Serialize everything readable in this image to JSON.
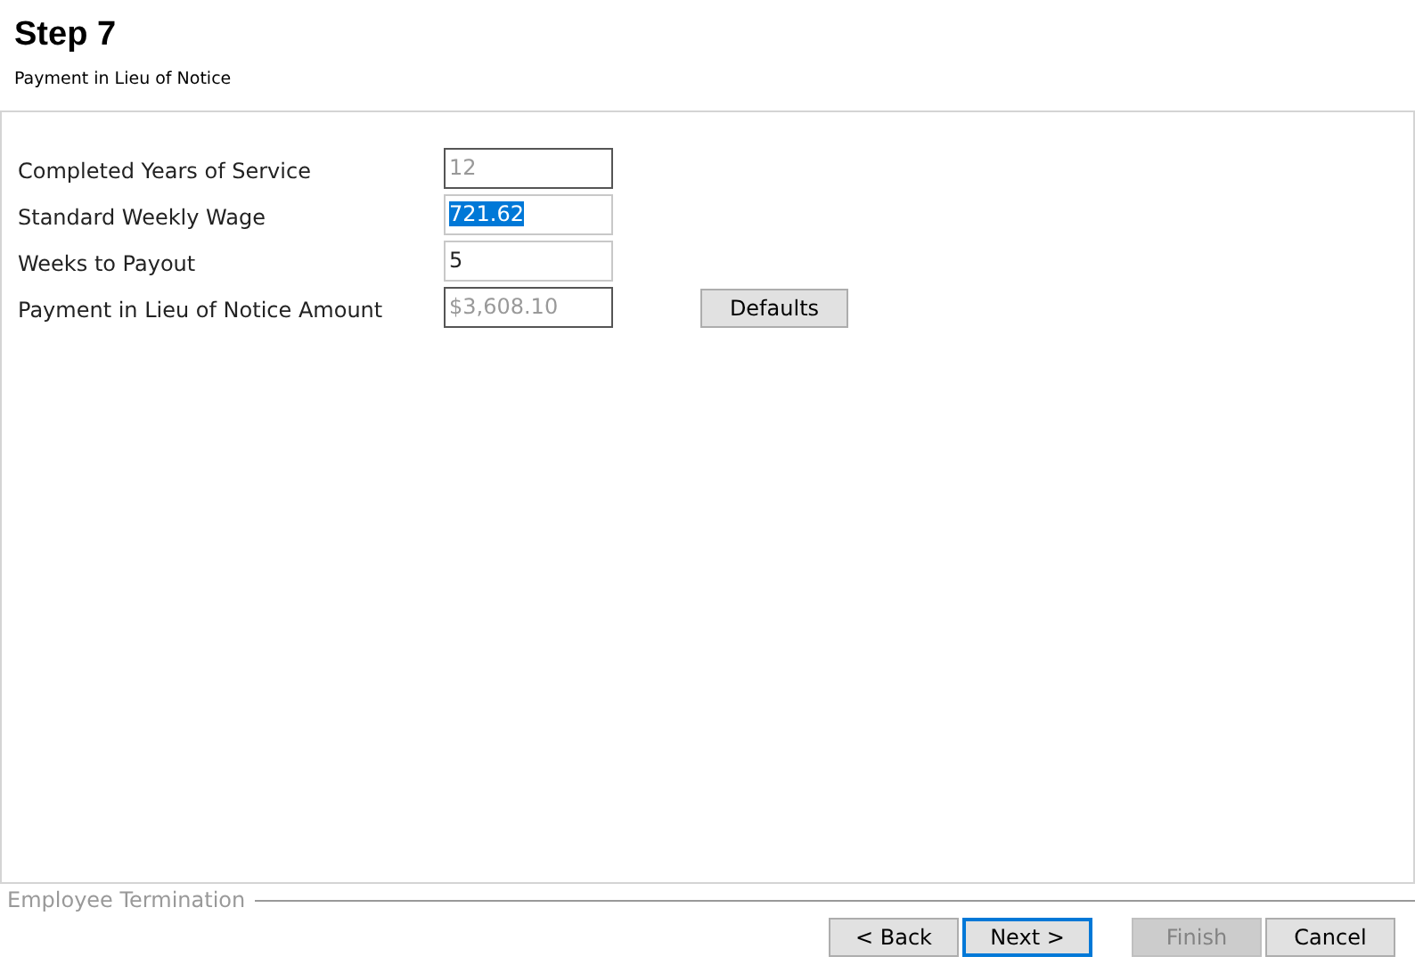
{
  "header": {
    "title": "Step 7",
    "subtitle": "Payment in Lieu of Notice"
  },
  "fields": [
    {
      "label": "Completed Years of Service",
      "value": "12",
      "readonly": true,
      "text_selected": false
    },
    {
      "label": "Standard Weekly Wage",
      "value": "721.62",
      "readonly": false,
      "text_selected": true
    },
    {
      "label": "Weeks to Payout",
      "value": "5",
      "readonly": false,
      "text_selected": false
    },
    {
      "label": "Payment in Lieu of Notice Amount",
      "value": "$3,608.10",
      "readonly": true,
      "text_selected": false
    }
  ],
  "defaults_button": "Defaults",
  "footer": {
    "group_label": "Employee Termination"
  },
  "buttons": [
    {
      "label": "< Back",
      "disabled": false,
      "default": false
    },
    {
      "label": "Next >",
      "disabled": false,
      "default": true
    },
    {
      "label": "Finish",
      "disabled": true,
      "default": false
    },
    {
      "label": "Cancel",
      "disabled": false,
      "default": false
    }
  ]
}
